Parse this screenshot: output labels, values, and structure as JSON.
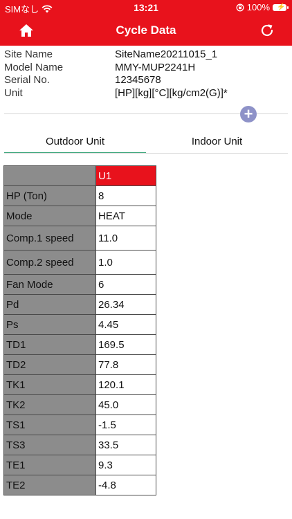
{
  "status_bar": {
    "carrier": "SIMなし",
    "time": "13:21",
    "battery": "100%"
  },
  "nav": {
    "title": "Cycle Data"
  },
  "site_info": [
    {
      "label": "Site Name",
      "value": "SiteName20211015_1"
    },
    {
      "label": "Model Name",
      "value": "MMY-MUP2241H"
    },
    {
      "label": "Serial No.",
      "value": "12345678"
    },
    {
      "label": "Unit",
      "value": "[HP][kg][°C][kg/cm2(G)]*"
    }
  ],
  "add_button": {
    "glyph": "+"
  },
  "tabs": [
    {
      "label": "Outdoor Unit",
      "active": true
    },
    {
      "label": "Indoor Unit",
      "active": false
    }
  ],
  "table": {
    "unit_header": "U1",
    "rows": [
      {
        "label": "HP (Ton)",
        "value": "8"
      },
      {
        "label": "Mode",
        "value": "HEAT"
      },
      {
        "label": "Comp.1 speed",
        "value": "11.0"
      },
      {
        "label": "Comp.2 speed",
        "value": "1.0"
      },
      {
        "label": "Fan Mode",
        "value": "6"
      },
      {
        "label": "Pd",
        "value": "26.34"
      },
      {
        "label": "Ps",
        "value": "4.45"
      },
      {
        "label": "TD1",
        "value": "169.5"
      },
      {
        "label": "TD2",
        "value": "77.8"
      },
      {
        "label": "TK1",
        "value": "120.1"
      },
      {
        "label": "TK2",
        "value": "45.0"
      },
      {
        "label": "TS1",
        "value": "-1.5"
      },
      {
        "label": "TS3",
        "value": "33.5"
      },
      {
        "label": "TE1",
        "value": "9.3"
      },
      {
        "label": "TE2",
        "value": "-4.8"
      }
    ]
  },
  "colors": {
    "accent": "#e8121c",
    "header_cell": "#8c8c8c",
    "tab_underline": "#3aa57a"
  }
}
